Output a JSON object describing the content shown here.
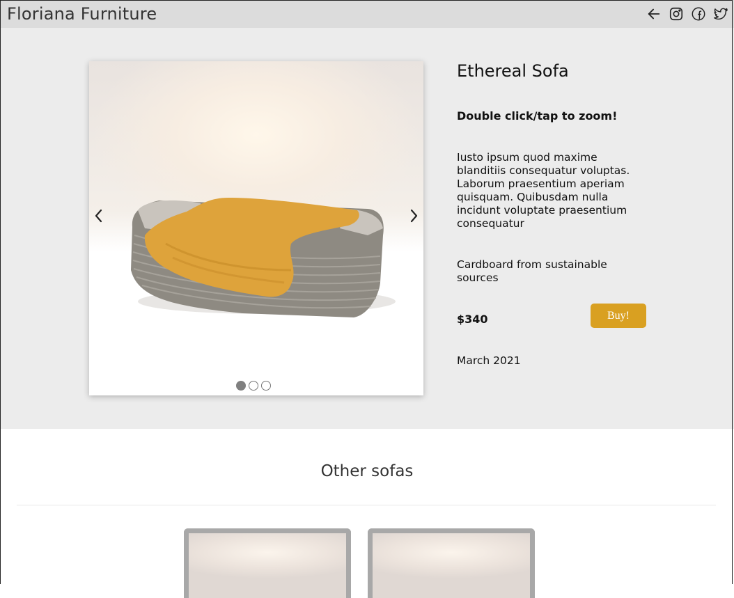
{
  "header": {
    "brand": "Floriana Furniture",
    "icons": [
      "back-arrow-icon",
      "instagram-icon",
      "facebook-icon",
      "twitter-icon"
    ]
  },
  "product": {
    "title": "Ethereal Sofa",
    "zoom_hint": "Double click/tap to zoom!",
    "description": "Iusto ipsum quod maxime blanditiis consequatur voluptas. Laborum praesentium aperiam quisquam. Quibusdam nulla incidunt voluptate praesentium consequatur",
    "material": "Cardboard from sustainable sources",
    "price": "$340",
    "buy_label": "Buy!",
    "date": "March 2021",
    "carousel": {
      "slide_count": 3,
      "active_slide": 1
    }
  },
  "other": {
    "title": "Other sofas",
    "cards": 2
  },
  "colors": {
    "accent": "#d9a021",
    "header_bg": "#dcdcdc",
    "section_bg": "#ececec"
  }
}
